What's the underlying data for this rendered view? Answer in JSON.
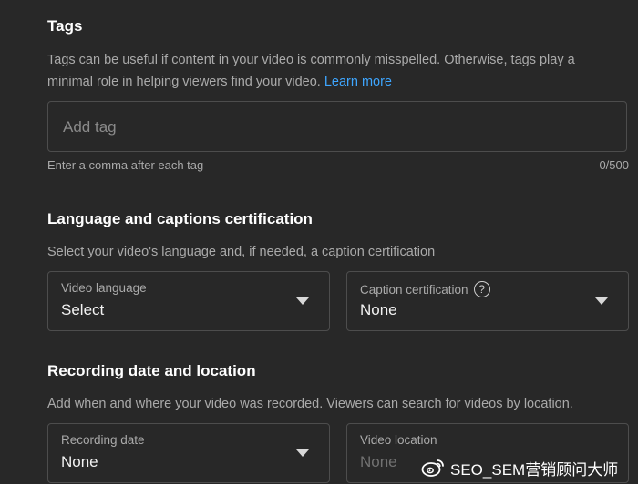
{
  "tags": {
    "title": "Tags",
    "description_line1": "Tags can be useful if content in your video is commonly misspelled. Otherwise, tags play a",
    "description_line2": "minimal role in helping viewers find your video.",
    "learn_more": "Learn more",
    "input_placeholder": "Add tag",
    "input_value": "",
    "hint": "Enter a comma after each tag",
    "counter": "0/500"
  },
  "language": {
    "title": "Language and captions certification",
    "description": "Select your video's language and, if needed, a caption certification",
    "video_language_label": "Video language",
    "video_language_value": "Select",
    "caption_label": "Caption certification",
    "caption_value": "None",
    "help_glyph": "?"
  },
  "recording": {
    "title": "Recording date and location",
    "description": "Add when and where your video was recorded. Viewers can search for videos by location.",
    "date_label": "Recording date",
    "date_value": "None",
    "location_label": "Video location",
    "location_value": "None"
  },
  "watermark": {
    "icon": "weibo-logo",
    "text": "SEO_SEM营销顾问大师"
  },
  "colors": {
    "background": "#282828",
    "link": "#3ea6ff",
    "border": "#4d4d4d"
  }
}
